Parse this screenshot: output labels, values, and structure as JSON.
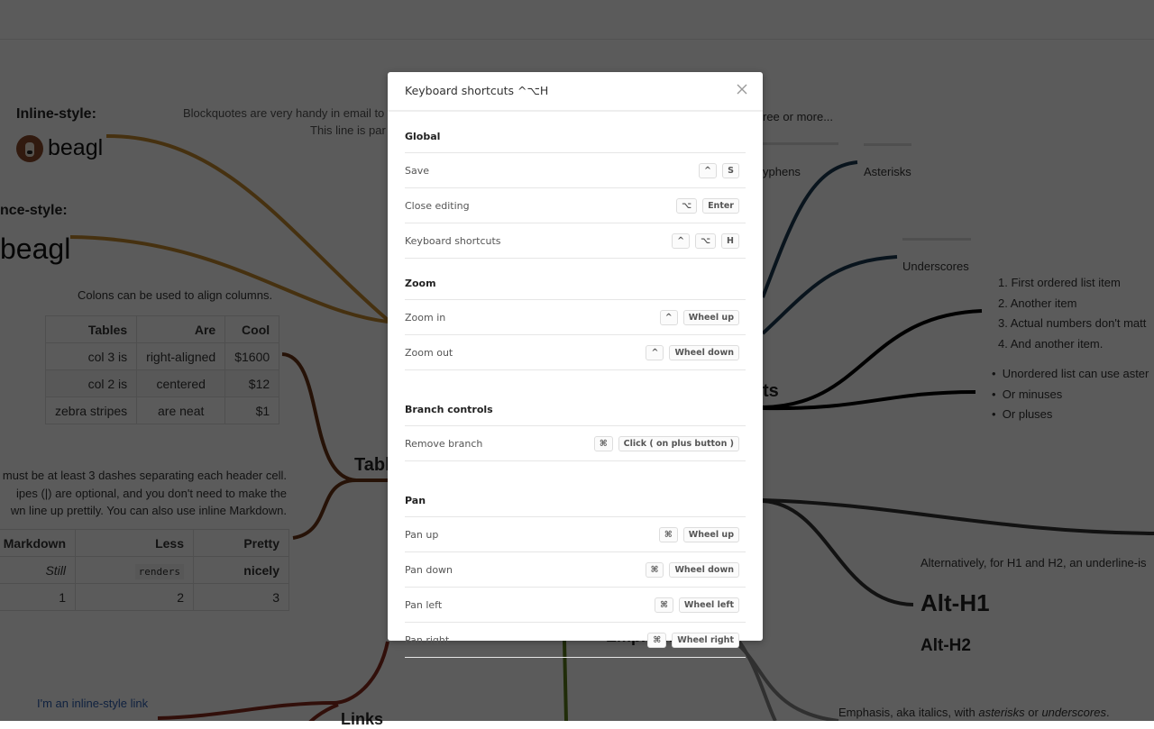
{
  "background": {
    "blockquote": {
      "line1": "Blockquotes are very handy in email to",
      "line2": "This line is par"
    },
    "three_or_more": "ree or more...",
    "images": {
      "inline_label": "Inline-style:",
      "inline_alt": "beagl",
      "reference_label": "nce-style:",
      "reference_alt": "beagl"
    },
    "tables_node": {
      "title": "Tabl",
      "colons_note": "Colons can be used to align columns.",
      "table1": {
        "headers": [
          "Tables",
          "Are",
          "Cool"
        ],
        "rows": [
          [
            "col 3 is",
            "right-aligned",
            "$1600"
          ],
          [
            "col 2 is",
            "centered",
            "$12"
          ],
          [
            "zebra stripes",
            "are neat",
            "$1"
          ]
        ]
      },
      "dashes_note": [
        "must be at least 3 dashes separating each header cell.",
        "ipes (|) are optional, and you don't need to make the",
        "wn line up prettily. You can also use inline Markdown."
      ],
      "table2": {
        "headers": [
          "Markdown",
          "Less",
          "Pretty"
        ],
        "rows": [
          [
            "Still",
            "renders",
            "nicely"
          ],
          [
            "1",
            "2",
            "3"
          ]
        ]
      }
    },
    "links_node": {
      "title": "Links",
      "inline_link": "I'm an inline-style link"
    },
    "hr_node": {
      "hyphens": "yphens",
      "asterisks": "Asterisks",
      "underscores": "Underscores"
    },
    "lists_node": {
      "title": "ts",
      "ordered": [
        "1. First ordered list item",
        "2. Another item",
        "3. Actual numbers don't matt",
        "4. And another item."
      ],
      "unordered": [
        "Unordered list can use aster",
        "Or minuses",
        "Or pluses"
      ]
    },
    "headers_node": {
      "alt_note": "Alternatively, for H1 and H2, an underline-is",
      "alt_h1": "Alt-H1",
      "alt_h2": "Alt-H2"
    },
    "emphasis_node": {
      "title": "Emphasis",
      "note_prefix": "Emphasis, aka italics, with ",
      "note_em1": "asterisks",
      "note_mid": " or ",
      "note_em2": "underscores",
      "note_suffix": "."
    }
  },
  "modal": {
    "title": "Keyboard shortcuts ^⌥H",
    "close_icon": "close-icon",
    "sections": [
      {
        "title": "Global",
        "rows": [
          {
            "label": "Save",
            "keys": [
              "^",
              "S"
            ]
          },
          {
            "label": "Close editing",
            "keys": [
              "⌥",
              "Enter"
            ]
          },
          {
            "label": "Keyboard shortcuts",
            "keys": [
              "^",
              "⌥",
              "H"
            ]
          }
        ]
      },
      {
        "title": "Zoom",
        "rows": [
          {
            "label": "Zoom in",
            "keys": [
              "^",
              "Wheel up"
            ]
          },
          {
            "label": "Zoom out",
            "keys": [
              "^",
              "Wheel down"
            ]
          }
        ]
      },
      {
        "title": "Branch controls",
        "rows": [
          {
            "label": "Remove branch",
            "keys": [
              "⌘",
              "Click ( on plus button )"
            ]
          }
        ]
      },
      {
        "title": "Pan",
        "rows": [
          {
            "label": "Pan up",
            "keys": [
              "⌘",
              "Wheel up"
            ]
          },
          {
            "label": "Pan down",
            "keys": [
              "⌘",
              "Wheel down"
            ]
          },
          {
            "label": "Pan left",
            "keys": [
              "⌘",
              "Wheel left"
            ]
          },
          {
            "label": "Pan right",
            "keys": [
              "⌘",
              "Wheel right"
            ]
          }
        ]
      }
    ]
  },
  "colors": {
    "images_branch": "#c58a2e",
    "tables_branch": "#6b3314",
    "links_branch": "#8a2a1c",
    "hr_branch": "#1b3a52",
    "lists_branch": "#000000",
    "headers_branch": "#333333",
    "code_branch": "#5a7d1a",
    "emphasis_branch": "#888888"
  }
}
